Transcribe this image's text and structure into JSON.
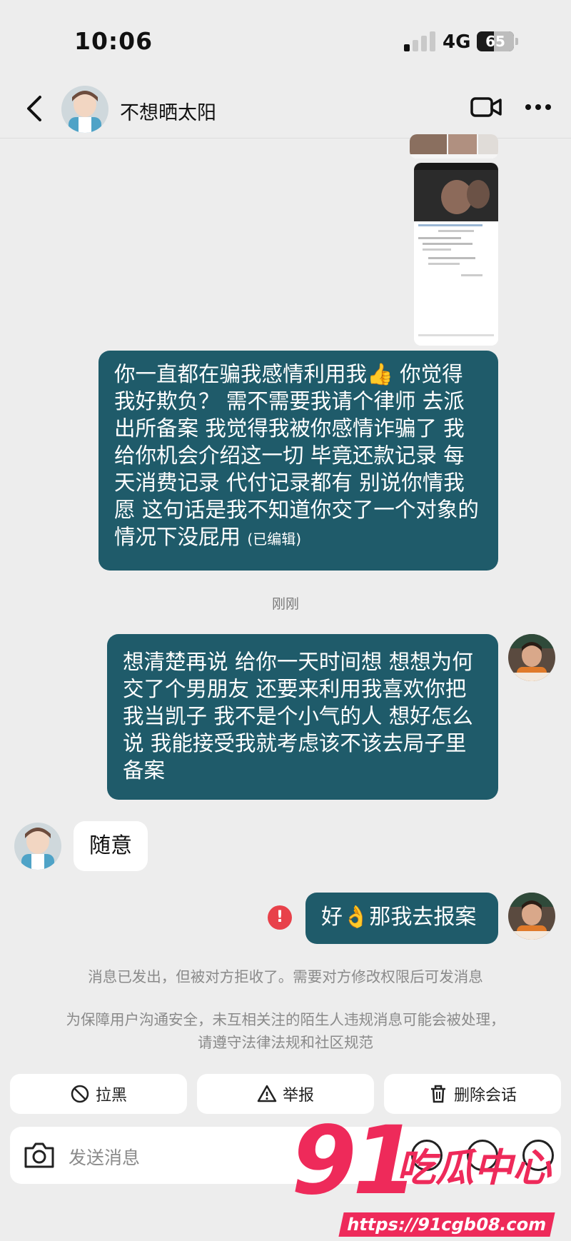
{
  "status_bar": {
    "time": "10:06",
    "network": "4G",
    "battery": "65"
  },
  "header": {
    "contact_name": "不想晒太阳",
    "icons": [
      "back-icon",
      "video-call-icon",
      "more-icon"
    ]
  },
  "messages": [
    {
      "side": "out",
      "text": "你一直都在骗我感情利用我👍 你觉得我好欺负？ 需不需要我请个律师 去派出所备案 我觉得我被你感情诈骗了 我给你机会介绍这一切 毕竟还款记录 每天消费记录 代付记录都有 别说你情我愿 这句话是我不知道你交了一个对象的情况下没屁用",
      "edited_tag": "(已编辑)"
    },
    {
      "side": "out",
      "text": "想清楚再说 给你一天时间想 想想为何交了个男朋友 还要来利用我喜欢你把我当凯子 我不是个小气的人 想好怎么说 我能接受我就考虑该不该去局子里备案"
    },
    {
      "side": "in",
      "text": "随意"
    },
    {
      "side": "out",
      "text": "好👌那我去报案",
      "status": "failed"
    }
  ],
  "timestamp": "刚刚",
  "notices": {
    "rejected": "消息已发出，但被对方拒收了。需要对方修改权限后可发消息",
    "safety": "为保障用户沟通安全，未互相关注的陌生人违规消息可能会被处理，请遵守法律法规和社区规范"
  },
  "actions": {
    "block": "拉黑",
    "report": "举报",
    "delete": "删除会话"
  },
  "input": {
    "placeholder": "发送消息"
  },
  "watermark": {
    "number": "91",
    "text": "吃瓜中心",
    "url": "https://91cgb08.com"
  },
  "colors": {
    "outgoing_bubble": "#1f5b6a",
    "incoming_bubble": "#ffffff",
    "background": "#ededed",
    "error": "#e8414a",
    "watermark": "#ee2a5a"
  }
}
